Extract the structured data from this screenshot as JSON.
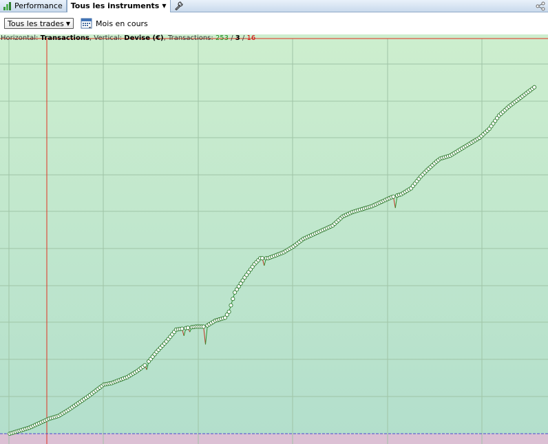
{
  "tabs": [
    {
      "label": "Performance",
      "icon": "bar-chart-icon",
      "active": false
    },
    {
      "label": "Tous les instruments",
      "icon": "",
      "active": true
    }
  ],
  "toolbar": {
    "trades_filter": "Tous les trades",
    "period_label": "Mois en cours"
  },
  "chart_header": {
    "horizontal_prefix": "Horizontal: ",
    "horizontal_value": "Transactions",
    "vertical_prefix": ", Vertical: ",
    "vertical_value": "Devise (€)",
    "transactions_prefix": ", Transactions: ",
    "total": "253",
    "sep1": " / ",
    "neutral": "3",
    "sep2": " / ",
    "losers": "16"
  },
  "colors": {
    "bg_top": "#cdeece",
    "bg_bottom": "#b3dfcc",
    "below_zero": "#dcc0d4",
    "grid": "#9fc4a6",
    "line_up": "#2d8f2d",
    "line_down": "#c03020",
    "marker_stroke": "#2d7a2d",
    "marker_fill": "#ffffff",
    "red_rule": "#e03020",
    "zero_line": "#4a4ad0"
  },
  "chart_data": {
    "type": "line",
    "title": "",
    "xlabel": "Transactions",
    "ylabel": "Devise (€)",
    "total_trades": 253,
    "neutral_trades": 3,
    "losing_trades": 16,
    "xlim": [
      -5,
      275
    ],
    "ylim": [
      -3,
      250
    ],
    "grid": true,
    "knots": [
      [
        0,
        0
      ],
      [
        10,
        4
      ],
      [
        20,
        10
      ],
      [
        25,
        12
      ],
      [
        30,
        16
      ],
      [
        40,
        25
      ],
      [
        45,
        30
      ],
      [
        48,
        33
      ],
      [
        52,
        34
      ],
      [
        60,
        38
      ],
      [
        65,
        42
      ],
      [
        70,
        47
      ],
      [
        75,
        55
      ],
      [
        80,
        62
      ],
      [
        85,
        70
      ],
      [
        95,
        72
      ],
      [
        100,
        72
      ],
      [
        105,
        76
      ],
      [
        110,
        78
      ],
      [
        112,
        82
      ],
      [
        115,
        95
      ],
      [
        120,
        105
      ],
      [
        125,
        114
      ],
      [
        128,
        118
      ],
      [
        132,
        118
      ],
      [
        140,
        122
      ],
      [
        145,
        126
      ],
      [
        150,
        131
      ],
      [
        155,
        134
      ],
      [
        160,
        137
      ],
      [
        165,
        140
      ],
      [
        170,
        146
      ],
      [
        175,
        149
      ],
      [
        180,
        151
      ],
      [
        185,
        153
      ],
      [
        190,
        156
      ],
      [
        195,
        159
      ],
      [
        200,
        161
      ],
      [
        205,
        165
      ],
      [
        210,
        173
      ],
      [
        213,
        177
      ],
      [
        218,
        183
      ],
      [
        220,
        185
      ],
      [
        225,
        187
      ],
      [
        230,
        191
      ],
      [
        235,
        195
      ],
      [
        240,
        199
      ],
      [
        245,
        205
      ],
      [
        250,
        214
      ],
      [
        255,
        220
      ],
      [
        260,
        225
      ],
      [
        268,
        233
      ]
    ],
    "dips": [
      {
        "x": 70,
        "drop": 4
      },
      {
        "x": 89,
        "drop": 5
      },
      {
        "x": 92,
        "drop": 3
      },
      {
        "x": 100,
        "drop": 12
      },
      {
        "x": 130,
        "drop": 5
      },
      {
        "x": 197,
        "drop": 8
      }
    ]
  }
}
